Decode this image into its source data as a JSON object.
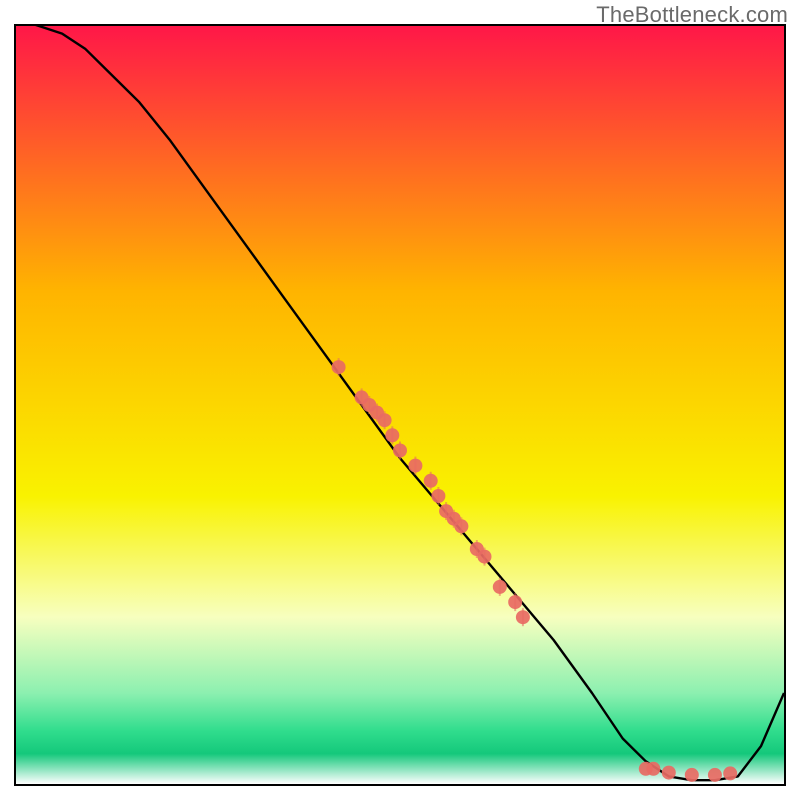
{
  "watermark": "TheBottleneck.com",
  "gradient": {
    "top": "#ff1748",
    "upper_mid": "#ffb400",
    "lower_mid": "#f9f200",
    "pale": "#f7ffbf",
    "green1": "#8cf0b0",
    "green2": "#30dd8d",
    "green3": "#14c87b",
    "bottom": "#ffffff"
  },
  "chart_data": {
    "type": "line",
    "title": "",
    "xlabel": "",
    "ylabel": "",
    "xlim": [
      0,
      100
    ],
    "ylim": [
      0,
      100
    ],
    "series": [
      {
        "name": "curve",
        "x": [
          0,
          3,
          6,
          9,
          12,
          16,
          20,
          25,
          30,
          35,
          40,
          45,
          50,
          55,
          60,
          65,
          70,
          75,
          79,
          82,
          85,
          88,
          91,
          94,
          97,
          100
        ],
        "y": [
          101,
          100,
          99,
          97,
          94,
          90,
          85,
          78,
          71,
          64,
          57,
          50,
          43,
          37,
          31,
          25,
          19,
          12,
          6,
          3,
          1,
          0.5,
          0.5,
          1,
          5,
          12
        ]
      }
    ],
    "scatter": {
      "name": "points",
      "color": "#e86a63",
      "x": [
        42,
        45,
        46,
        47,
        48,
        49,
        50,
        52,
        54,
        55,
        56,
        57,
        58,
        60,
        61,
        63,
        65,
        66,
        82,
        83,
        85,
        88,
        91,
        93
      ],
      "y": [
        55,
        51,
        50,
        49,
        48,
        46,
        44,
        42,
        40,
        38,
        36,
        35,
        34,
        31,
        30,
        26,
        24,
        22,
        2,
        2,
        1.5,
        1.2,
        1.2,
        1.4
      ]
    },
    "baseline_y": 0
  }
}
